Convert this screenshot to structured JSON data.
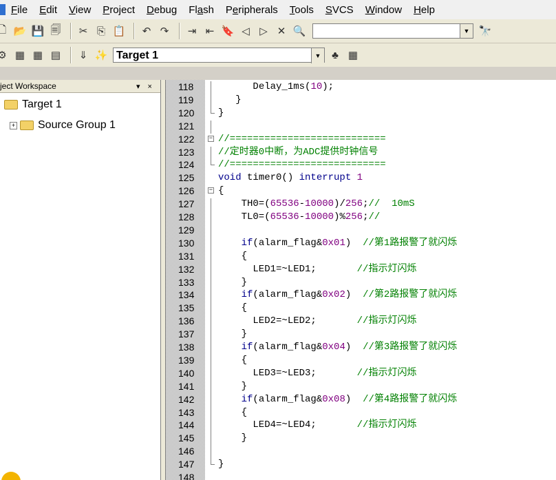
{
  "menu": [
    {
      "label": "File",
      "u": 0
    },
    {
      "label": "Edit",
      "u": 0
    },
    {
      "label": "View",
      "u": 0
    },
    {
      "label": "Project",
      "u": 0
    },
    {
      "label": "Debug",
      "u": 0
    },
    {
      "label": "Flash",
      "u": 2
    },
    {
      "label": "Peripherals",
      "u": 1
    },
    {
      "label": "Tools",
      "u": 0
    },
    {
      "label": "SVCS",
      "u": 0
    },
    {
      "label": "Window",
      "u": 0
    },
    {
      "label": "Help",
      "u": 0
    }
  ],
  "toolbar": {
    "find_value": "",
    "target_value": "Target 1"
  },
  "workspace": {
    "title": "ject Workspace",
    "controls": "▾ ×",
    "root": "Target 1",
    "group": "Source Group 1"
  },
  "code_lines": [
    {
      "n": "118",
      "html": "      <span>Delay_1ms(</span><span class=\"num\">10</span><span>);</span>"
    },
    {
      "n": "119",
      "html": "   }"
    },
    {
      "n": "120",
      "html": "}"
    },
    {
      "n": "121",
      "html": ""
    },
    {
      "n": "122",
      "html": "<span class=\"cmt\">//===========================</span>"
    },
    {
      "n": "123",
      "html": "<span class=\"cmt\">//定时器0中断，为ADC提供时钟信号</span>"
    },
    {
      "n": "124",
      "html": "<span class=\"cmt\">//===========================</span>"
    },
    {
      "n": "125",
      "html": "<span class=\"kw\">void</span> timer0() <span class=\"kw\">interrupt</span> <span class=\"num\">1</span>"
    },
    {
      "n": "126",
      "html": "{"
    },
    {
      "n": "127",
      "html": "    TH0=(<span class=\"num\">65536</span>-<span class=\"num\">10000</span>)/<span class=\"num\">256</span>;<span class=\"cmt\">//  10mS</span>"
    },
    {
      "n": "128",
      "html": "    TL0=(<span class=\"num\">65536</span>-<span class=\"num\">10000</span>)%<span class=\"num\">256</span>;<span class=\"cmt\">//</span>"
    },
    {
      "n": "129",
      "html": ""
    },
    {
      "n": "130",
      "html": "    <span class=\"kw\">if</span>(alarm_flag&amp;<span class=\"num\">0x01</span>)  <span class=\"cmt\">//第1路报警了就闪烁</span>"
    },
    {
      "n": "131",
      "html": "    {"
    },
    {
      "n": "132",
      "html": "      LED1=~LED1;       <span class=\"cmt\">//指示灯闪烁</span>"
    },
    {
      "n": "133",
      "html": "    }"
    },
    {
      "n": "134",
      "html": "    <span class=\"kw\">if</span>(alarm_flag&amp;<span class=\"num\">0x02</span>)  <span class=\"cmt\">//第2路报警了就闪烁</span>"
    },
    {
      "n": "135",
      "html": "    {"
    },
    {
      "n": "136",
      "html": "      LED2=~LED2;       <span class=\"cmt\">//指示灯闪烁</span>"
    },
    {
      "n": "137",
      "html": "    }"
    },
    {
      "n": "138",
      "html": "    <span class=\"kw\">if</span>(alarm_flag&amp;<span class=\"num\">0x04</span>)  <span class=\"cmt\">//第3路报警了就闪烁</span>"
    },
    {
      "n": "139",
      "html": "    {"
    },
    {
      "n": "140",
      "html": "      LED3=~LED3;       <span class=\"cmt\">//指示灯闪烁</span>"
    },
    {
      "n": "141",
      "html": "    }"
    },
    {
      "n": "142",
      "html": "    <span class=\"kw\">if</span>(alarm_flag&amp;<span class=\"num\">0x08</span>)  <span class=\"cmt\">//第4路报警了就闪烁</span>"
    },
    {
      "n": "143",
      "html": "    {"
    },
    {
      "n": "144",
      "html": "      LED4=~LED4;       <span class=\"cmt\">//指示灯闪烁</span>"
    },
    {
      "n": "145",
      "html": "    }"
    },
    {
      "n": "146",
      "html": ""
    },
    {
      "n": "147",
      "html": "}"
    },
    {
      "n": "148",
      "html": ""
    }
  ]
}
